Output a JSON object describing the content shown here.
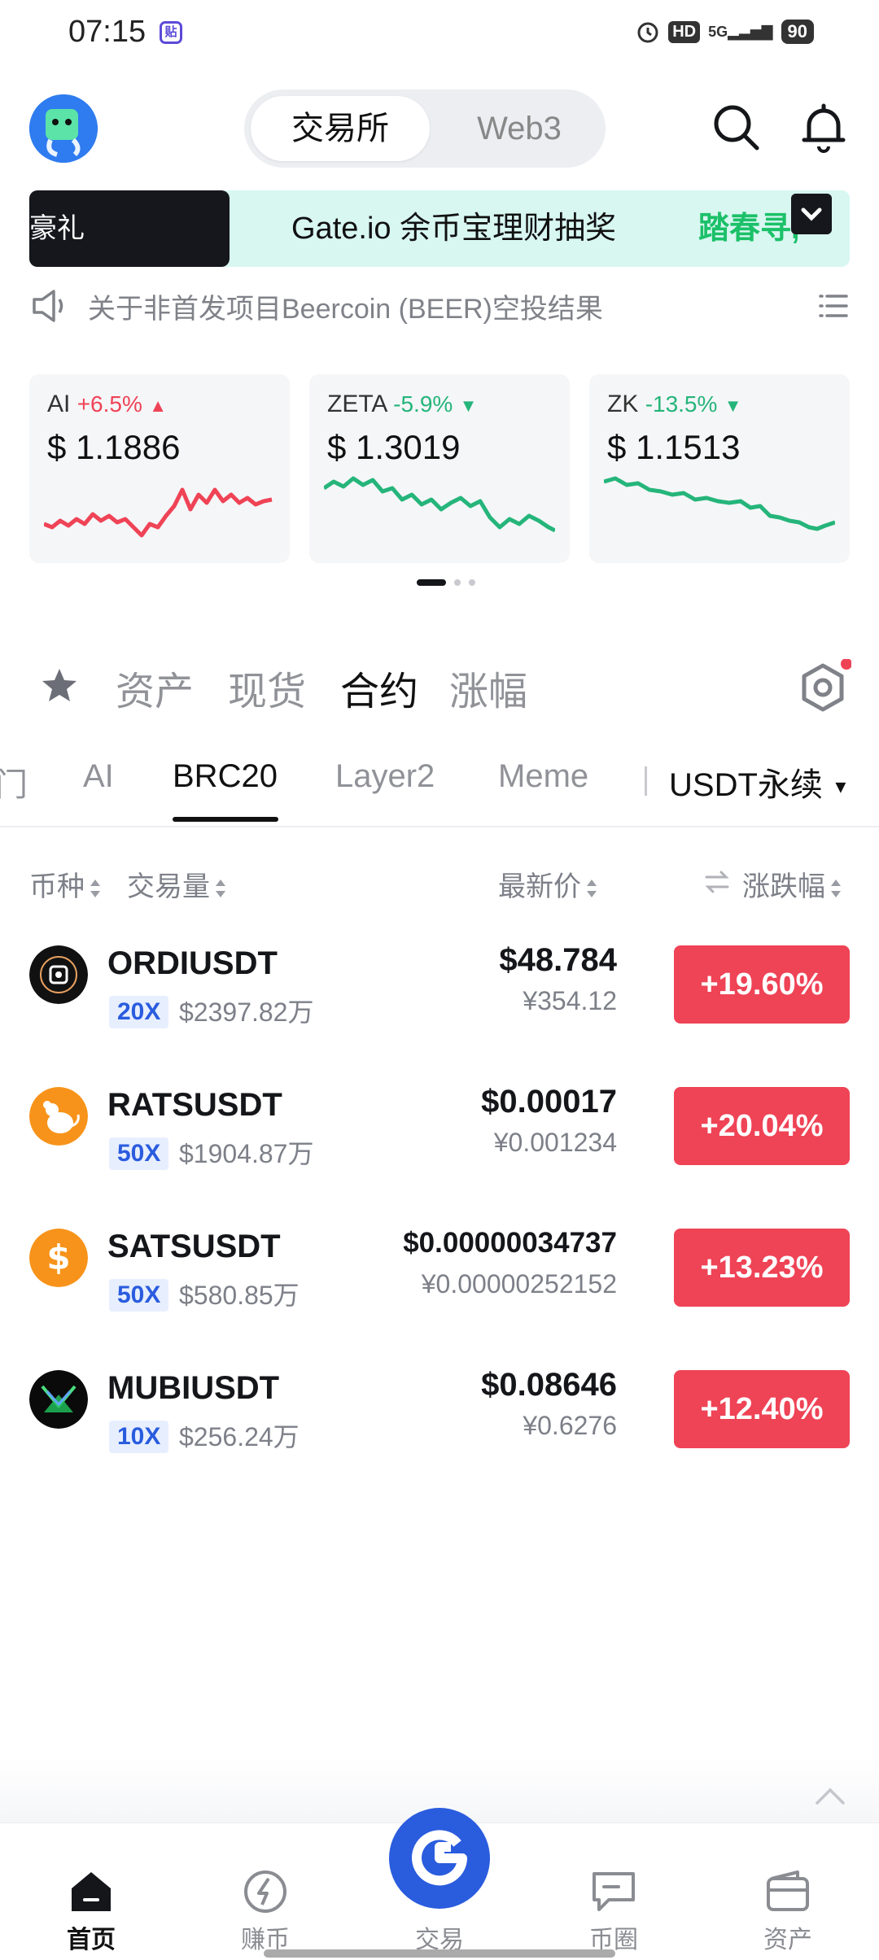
{
  "status_bar": {
    "time": "07:15",
    "app_badge": "贴",
    "hd": "HD",
    "signal": "5G",
    "battery": "90"
  },
  "header": {
    "seg_active": "交易所",
    "seg_inactive": "Web3"
  },
  "banner": {
    "left_text": "豪礼",
    "main_text": "Gate.io 余币宝理财抽奖",
    "promo_text": "踏春寻,"
  },
  "announcement": {
    "text": "关于非首发项目Beercoin (BEER)空投结果"
  },
  "tickers": [
    {
      "name": "AI",
      "change": "+6.5%",
      "direction": "up",
      "price": "$ 1.1886",
      "color": "#ef4356"
    },
    {
      "name": "ZETA",
      "change": "-5.9%",
      "direction": "down",
      "price": "$ 1.3019",
      "color": "#25b57a"
    },
    {
      "name": "ZK",
      "change": "-13.5%",
      "direction": "down",
      "price": "$ 1.1513",
      "color": "#25b57a"
    }
  ],
  "main_tabs": [
    "资产",
    "现货",
    "合约",
    "涨幅"
  ],
  "active_main_tab": "合约",
  "sub_tabs": [
    "门",
    "AI",
    "BRC20",
    "Layer2",
    "Meme"
  ],
  "active_sub_tab": "BRC20",
  "market_selector": "USDT永续",
  "columns": {
    "coin": "币种",
    "volume": "交易量",
    "price": "最新价",
    "change": "涨跌幅"
  },
  "rows": [
    {
      "symbol": "ORDIUSDT",
      "leverage": "20X",
      "volume": "$2397.82万",
      "price": "$48.784",
      "cny": "¥354.12",
      "change": "+19.60%",
      "icon": "ordi-icon"
    },
    {
      "symbol": "RATSUSDT",
      "leverage": "50X",
      "volume": "$1904.87万",
      "price": "$0.00017",
      "cny": "¥0.001234",
      "change": "+20.04%",
      "icon": "rats-icon"
    },
    {
      "symbol": "SATSUSDT",
      "leverage": "50X",
      "volume": "$580.85万",
      "price": "$0.00000034737",
      "cny": "¥0.00000252152",
      "change": "+13.23%",
      "icon": "sats-icon"
    },
    {
      "symbol": "MUBIUSDT",
      "leverage": "10X",
      "volume": "$256.24万",
      "price": "$0.08646",
      "cny": "¥0.6276",
      "change": "+12.40%",
      "icon": "mubi-icon"
    }
  ],
  "nav": [
    {
      "label": "首页",
      "icon": "home-icon",
      "active": true
    },
    {
      "label": "赚币",
      "icon": "earn-icon",
      "active": false
    },
    {
      "label": "交易",
      "icon": "trade-icon",
      "active": false
    },
    {
      "label": "币圈",
      "icon": "chat-icon",
      "active": false
    },
    {
      "label": "资产",
      "icon": "wallet-icon",
      "active": false
    }
  ],
  "colors": {
    "up": "#ef4356",
    "down": "#25b57a",
    "accent": "#2a5cde"
  }
}
